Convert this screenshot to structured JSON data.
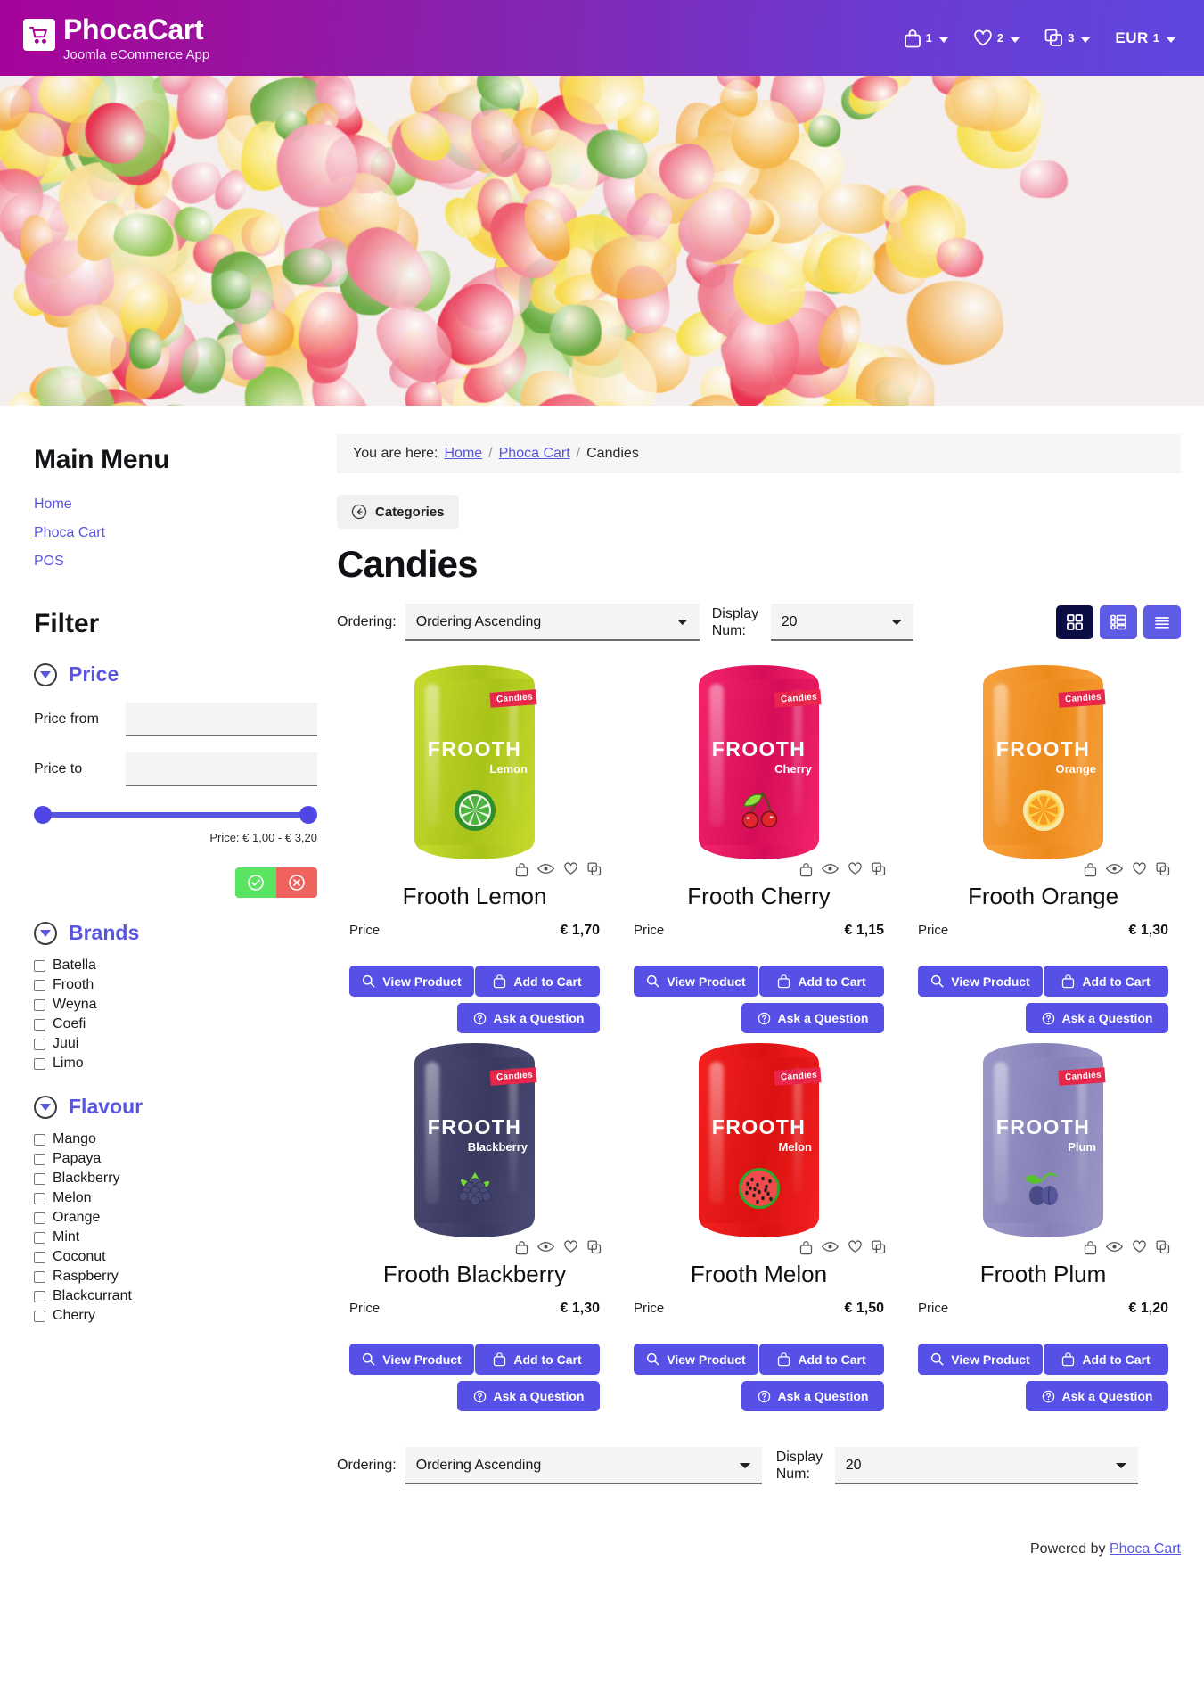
{
  "header": {
    "brand_title": "PhocaCart",
    "brand_subtitle": "Joomla eCommerce App",
    "logo_icon": "shopping-cart-icon",
    "nav": [
      {
        "icon": "bag-icon",
        "name": "cart",
        "count": "1"
      },
      {
        "icon": "heart-icon",
        "name": "wishlist",
        "count": "2"
      },
      {
        "icon": "copy-icon",
        "name": "compare",
        "count": "3"
      }
    ],
    "currency": {
      "label": "EUR",
      "count": "1"
    }
  },
  "sidebar": {
    "menu_title": "Main Menu",
    "menu_items": [
      {
        "label": "Home",
        "active": false
      },
      {
        "label": "Phoca Cart",
        "active": true
      },
      {
        "label": "POS",
        "active": false
      }
    ],
    "filter_title": "Filter",
    "price": {
      "group_title": "Price",
      "from_label": "Price from",
      "to_label": "Price to",
      "from_value": "",
      "to_value": "",
      "from_placeholder": "",
      "to_placeholder": "",
      "range_note": "Price: € 1,00 - € 3,20",
      "apply_icon": "check-circle-icon",
      "reset_icon": "x-circle-icon",
      "apply_color": "#5be362",
      "reset_color": "#f0625e"
    },
    "brands": {
      "group_title": "Brands",
      "items": [
        "Batella",
        "Frooth",
        "Weyna",
        "Coefi",
        "Juui",
        "Limo"
      ]
    },
    "flavour": {
      "group_title": "Flavour",
      "items": [
        "Mango",
        "Papaya",
        "Blackberry",
        "Melon",
        "Orange",
        "Mint",
        "Coconut",
        "Raspberry",
        "Blackcurrant",
        "Cherry"
      ]
    }
  },
  "breadcrumb": {
    "prefix": "You are here:",
    "items": [
      "Home",
      "Phoca Cart",
      "Candies"
    ],
    "separator": "/"
  },
  "main": {
    "categories_button": "Categories",
    "categories_icon": "arrow-left-circle-icon",
    "page_title": "Candies",
    "ordering_label": "Ordering:",
    "ordering_value": "Ordering Ascending",
    "display_label": "Display Num:",
    "display_value": "20",
    "views": [
      {
        "name": "grid-view",
        "icon": "grid-icon",
        "active": true
      },
      {
        "name": "list-view",
        "icon": "list-grid-icon",
        "active": false
      },
      {
        "name": "compact-view",
        "icon": "lines-icon",
        "active": false
      }
    ],
    "view_active_color": "#0d0d45",
    "view_color": "#5e5ce6",
    "accent_color": "#5650e6",
    "product_icons": [
      "bag-icon",
      "eye-icon",
      "heart-icon",
      "copy-icon"
    ],
    "price_label": "Price",
    "buttons": {
      "view_product": "View Product",
      "view_product_icon": "search-icon",
      "add_to_cart": "Add to Cart",
      "add_to_cart_icon": "bag-icon",
      "ask_question": "Ask a Question",
      "ask_question_icon": "question-circle-icon"
    },
    "bag_brand": "FROOTH",
    "bag_tag": "Candies",
    "products": [
      {
        "name": "Frooth Lemon",
        "flavour": "Lemon",
        "price": "€ 1,70",
        "bag_color": "#c6da2c",
        "bag_color2": "#a9c31b",
        "fruit": "lemon-slice-icon"
      },
      {
        "name": "Frooth Cherry",
        "flavour": "Cherry",
        "price": "€ 1,15",
        "bag_color": "#f2246b",
        "bag_color2": "#d60d58",
        "fruit": "cherry-icon"
      },
      {
        "name": "Frooth Orange",
        "flavour": "Orange",
        "price": "€ 1,30",
        "bag_color": "#f7a13d",
        "bag_color2": "#ee8a1c",
        "fruit": "orange-slice-icon"
      },
      {
        "name": "Frooth Blackberry",
        "flavour": "Blackberry",
        "price": "€ 1,30",
        "bag_color": "#4a4a74",
        "bag_color2": "#3a3a60",
        "fruit": "blackberry-icon"
      },
      {
        "name": "Frooth Melon",
        "flavour": "Melon",
        "price": "€ 1,50",
        "bag_color": "#f32020",
        "bag_color2": "#db1111",
        "fruit": "watermelon-icon"
      },
      {
        "name": "Frooth Plum",
        "flavour": "Plum",
        "price": "€ 1,20",
        "bag_color": "#9b97c8",
        "bag_color2": "#8682b8",
        "fruit": "plum-icon"
      }
    ]
  },
  "footer": {
    "text": "Powered by",
    "link": "Phoca Cart"
  }
}
